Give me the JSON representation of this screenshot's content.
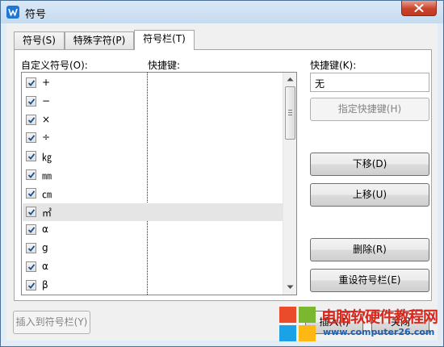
{
  "window": {
    "title": "符号",
    "close_icon": "close-icon",
    "app_icon": "wps-writer-icon"
  },
  "tabs": [
    {
      "label": "符号(S)"
    },
    {
      "label": "特殊字符(P)"
    },
    {
      "label": "符号栏(T)",
      "active": true
    }
  ],
  "list": {
    "header_symbols": "自定义符号(O):",
    "header_shortcut": "快捷键:",
    "items": [
      {
        "symbol": "+",
        "checked": true
      },
      {
        "symbol": "−",
        "checked": true
      },
      {
        "symbol": "×",
        "checked": true
      },
      {
        "symbol": "÷",
        "checked": true
      },
      {
        "symbol": "㎏",
        "checked": true
      },
      {
        "symbol": "㎜",
        "checked": true
      },
      {
        "symbol": "㎝",
        "checked": true
      },
      {
        "symbol": "㎡",
        "checked": true,
        "selected": true
      },
      {
        "symbol": "α",
        "checked": true
      },
      {
        "symbol": "g",
        "checked": true
      },
      {
        "symbol": "α",
        "checked": true
      },
      {
        "symbol": "β",
        "checked": true
      }
    ]
  },
  "shortcut": {
    "label": "快捷键(K):",
    "value": "无",
    "assign_button": "指定快捷键(H)"
  },
  "buttons": {
    "move_down": "下移(D)",
    "move_up": "上移(U)",
    "delete": "删除(R)",
    "reset": "重设符号栏(E)",
    "insert_to_bar": "插入到符号栏(Y)",
    "insert": "插入(I)",
    "close": "关闭"
  },
  "watermark": {
    "title": "电脑软硬件教程网",
    "url": "www.computer26.com"
  },
  "colors": {
    "accent": "#1e76d8",
    "check": "#1a4e8c",
    "watermark_red": "#d9281d",
    "watermark_blue": "#1e5fae"
  }
}
